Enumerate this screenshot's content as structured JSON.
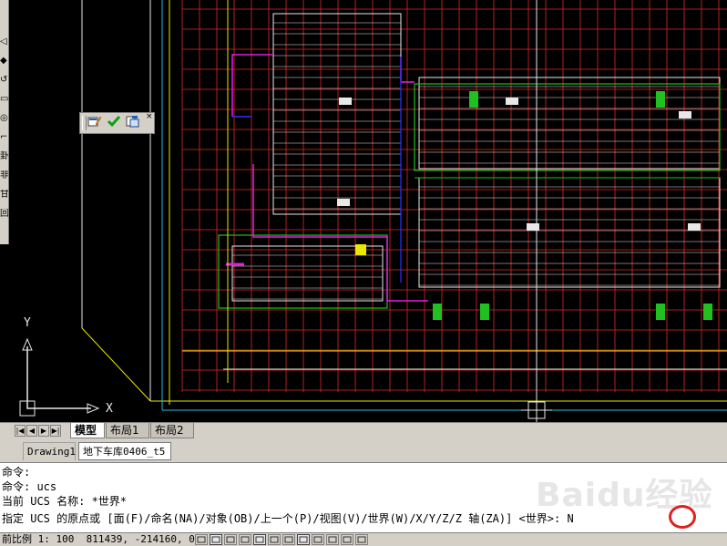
{
  "app": {
    "colors": {
      "canvas": "#000000",
      "grid_red": "#e02828",
      "grid_white": "#e8e8e8",
      "accent_green": "#20c020",
      "accent_magenta": "#e020e0",
      "accent_yellow": "#e8e800",
      "accent_cyan": "#20c0e0",
      "ui_face": "#d4d0c8",
      "highlight_red": "#e02020"
    }
  },
  "ucs": {
    "y_label": "Y",
    "x_label": "X"
  },
  "toolbar": {
    "icons": [
      "properties-edit-icon",
      "checkmark-icon",
      "layer-edit-icon"
    ],
    "close_label": "×"
  },
  "palette": {
    "glyphs": [
      "◁",
      "◆",
      "↺",
      "▭",
      "◎",
      "⌐",
      "卦",
      "非",
      "甘",
      "回"
    ]
  },
  "layout_tabs": {
    "nav": [
      "|◀",
      "◀",
      "▶",
      "▶|"
    ],
    "items": [
      {
        "label": "模型",
        "active": true
      },
      {
        "label": "布局1",
        "active": false
      },
      {
        "label": "布局2",
        "active": false
      }
    ]
  },
  "doc_tabs": [
    {
      "label": "Drawing1",
      "active": false
    },
    {
      "label": "地下车库0406_t5",
      "active": true
    }
  ],
  "command": {
    "lines": [
      "命令:",
      "命令: ucs",
      "当前 UCS 名称: *世界*",
      "指定 UCS 的原点或 [面(F)/命名(NA)/对象(OB)/上一个(P)/视图(V)/世界(W)/X/Y/Z/Z 轴(ZA)] <世界>: N"
    ],
    "watermark": "Baidu经验"
  },
  "status": {
    "scale_label": "前比例 1: 100",
    "coordinates": "811439, -214160, 0"
  }
}
